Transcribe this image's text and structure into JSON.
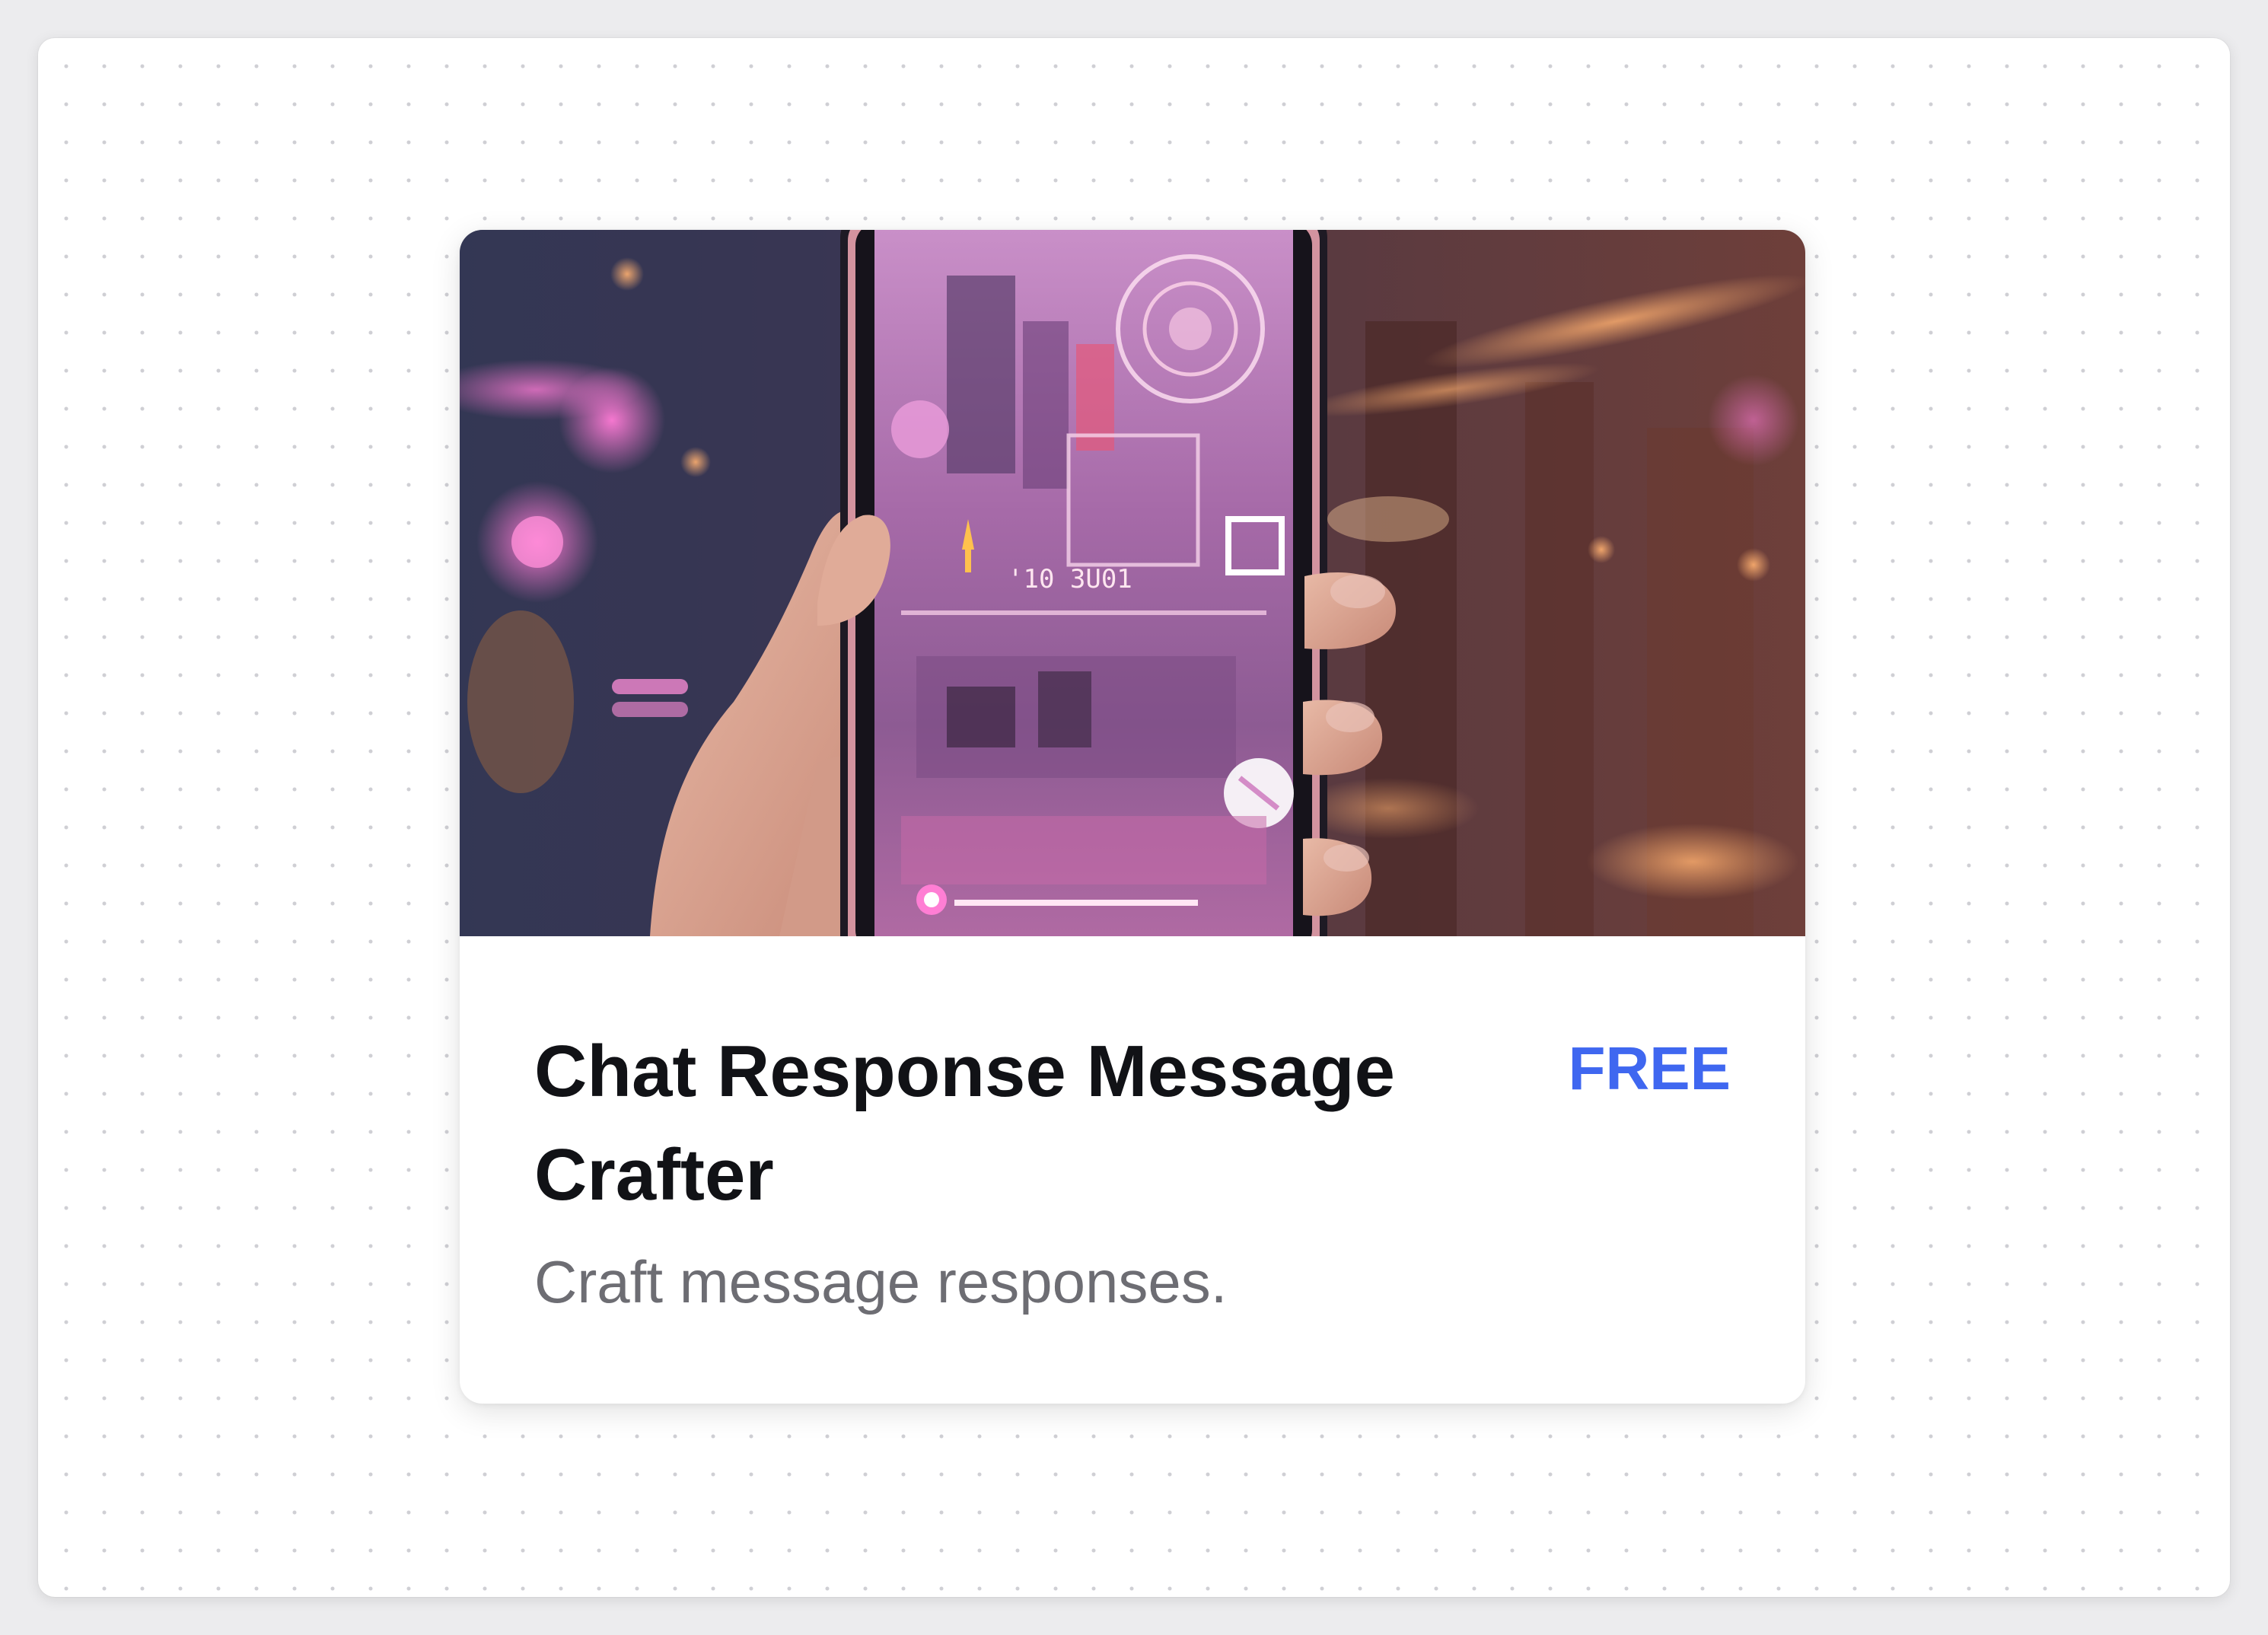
{
  "card": {
    "title": "Chat Response Message Crafter",
    "price": "FREE",
    "description": "Craft message responses."
  },
  "hero_image": {
    "subject": "hand-holding-phone-image",
    "screen_text": "'10 3U01"
  },
  "colors": {
    "accent": "#3f67f0",
    "title": "#111216",
    "description": "#6d6d73",
    "canvas": "#ffffff",
    "dot_grid": "#cfcfd4"
  }
}
